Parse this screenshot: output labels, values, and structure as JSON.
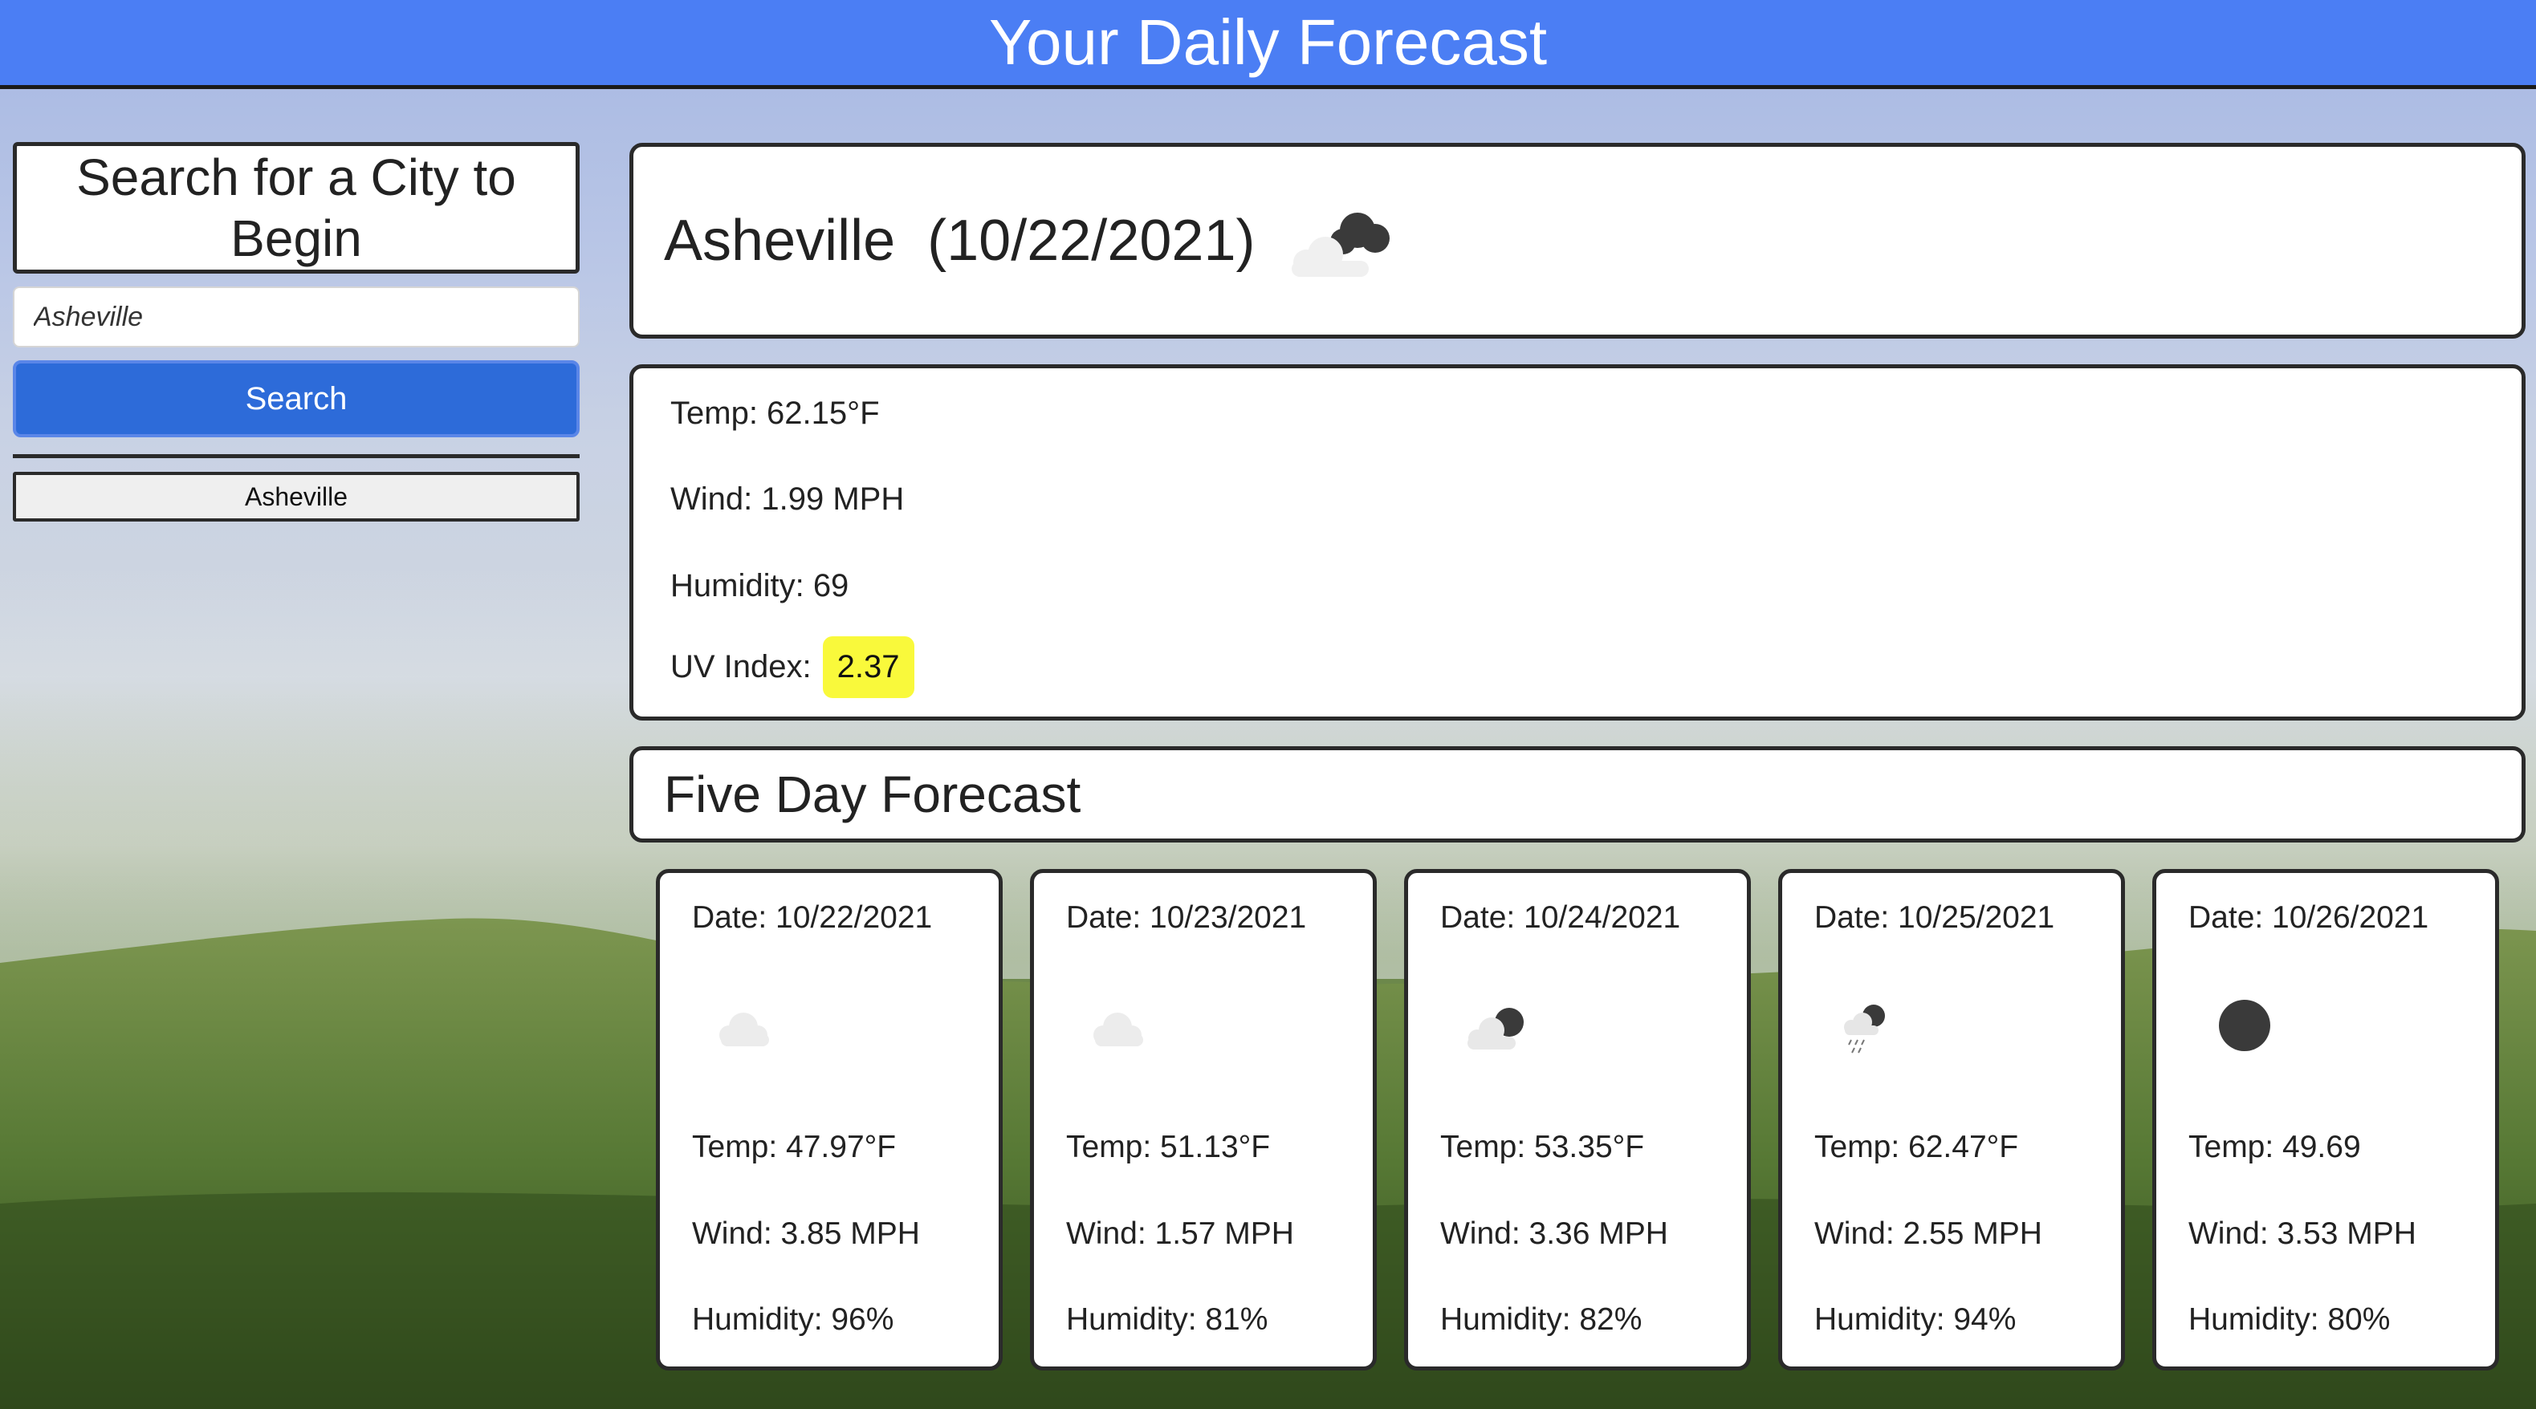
{
  "header": {
    "title": "Your Daily Forecast"
  },
  "sidebar": {
    "search_title": "Search for a City to Begin",
    "search_input_value": "Asheville",
    "search_button_label": "Search",
    "history": [
      "Asheville"
    ]
  },
  "current": {
    "city": "Asheville",
    "date": "(10/22/2021)",
    "icon": "cloud-night-icon",
    "temp": "Temp: 62.15°F",
    "wind": "Wind: 1.99 MPH",
    "humidity": "Humidity: 69",
    "uv_label": "UV Index:",
    "uv_value": "2.37"
  },
  "forecast": {
    "title": "Five Day Forecast",
    "days": [
      {
        "date": "Date: 10/22/2021",
        "icon": "cloud-icon",
        "temp": "Temp: 47.97°F",
        "wind": "Wind: 3.85 MPH",
        "humidity": "Humidity: 96%"
      },
      {
        "date": "Date: 10/23/2021",
        "icon": "cloud-icon",
        "temp": "Temp: 51.13°F",
        "wind": "Wind: 1.57 MPH",
        "humidity": "Humidity: 81%"
      },
      {
        "date": "Date: 10/24/2021",
        "icon": "partly-cloudy-night-icon",
        "temp": "Temp: 53.35°F",
        "wind": "Wind: 3.36 MPH",
        "humidity": "Humidity: 82%"
      },
      {
        "date": "Date: 10/25/2021",
        "icon": "rain-night-icon",
        "temp": "Temp: 62.47°F",
        "wind": "Wind: 2.55 MPH",
        "humidity": "Humidity: 94%"
      },
      {
        "date": "Date: 10/26/2021",
        "icon": "clear-night-icon",
        "temp": "Temp: 49.69",
        "wind": "Wind: 3.53 MPH",
        "humidity": "Humidity: 80%"
      }
    ]
  },
  "colors": {
    "header": "#4b7ef4",
    "search_button": "#2d6bd9",
    "uv_badge": "#f9f93b"
  }
}
